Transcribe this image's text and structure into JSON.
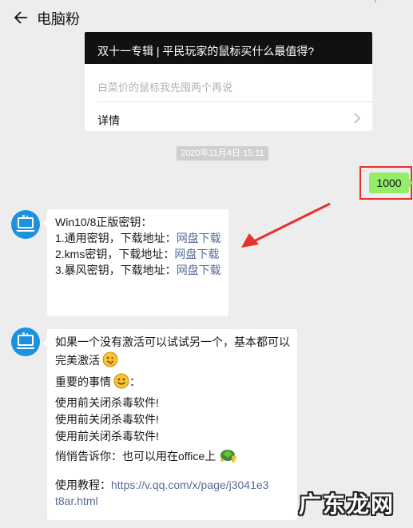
{
  "header": {
    "title": "电脑粉"
  },
  "article": {
    "title": "双十一专辑 | 平民玩家的鼠标买什么最值得?",
    "description": "白菜价的鼠标我先囤两个再说",
    "detail_label": "详情"
  },
  "timestamp": "2020年11月4日 15:11",
  "sent_message": "1000",
  "reply_1": {
    "line1": "Win10/8正版密钥：",
    "items": [
      {
        "prefix": "1.通用密钥，下载地址：",
        "link": "网盘下载"
      },
      {
        "prefix": "2.kms密钥，下载地址：",
        "link": "网盘下载"
      },
      {
        "prefix": "3.暴风密钥，下载地址：",
        "link": "网盘下载"
      }
    ]
  },
  "reply_2": {
    "line1": "如果一个没有激活可以试试另一个，基本都可以",
    "line2": "完美激活",
    "line3": "重要的事情",
    "line3_suffix": "：",
    "repeat": [
      "使用前关闭杀毒软件!",
      "使用前关闭杀毒软件!",
      "使用前关闭杀毒软件!"
    ],
    "secret": "悄悄告诉你：也可以用在office上",
    "tutorial_label": "使用教程：",
    "tutorial_url_1": "https://v.qq.com/x/page/j3041e3",
    "tutorial_url_2": "t8ar.html"
  },
  "watermark": "广东龙网",
  "icons": {
    "back": "arrow-left-icon",
    "more": "more-icon",
    "chevron": "chevron-right-icon",
    "avatar": "laptop-logo-avatar",
    "emoji_1": "tongue-out-emoji",
    "emoji_2": "smile-emoji",
    "emoji_3": "turtle-emoji",
    "annotation": "red-arrow"
  },
  "colors": {
    "background": "#ededed",
    "sent_bubble": "#95ec69",
    "link": "#576b95",
    "highlight": "#e8302e",
    "avatar": "#1a92e0"
  }
}
